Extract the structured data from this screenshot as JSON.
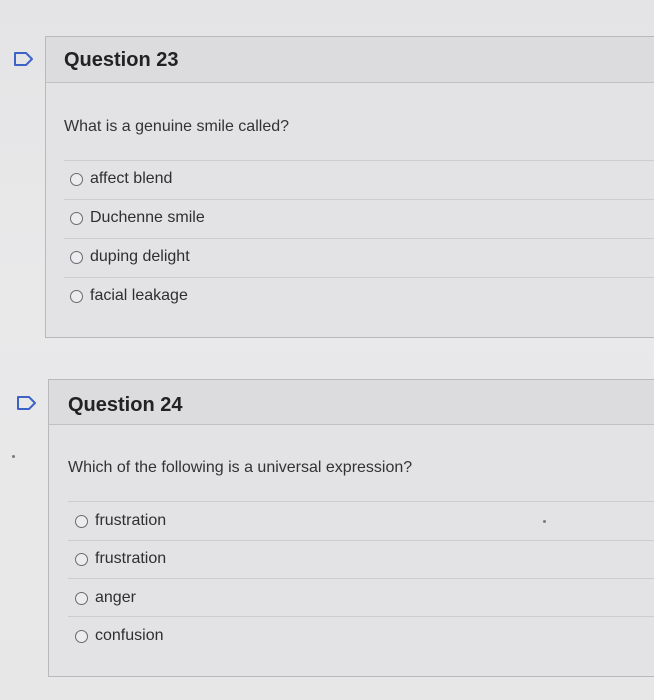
{
  "questions": [
    {
      "title": "Question 23",
      "prompt": "What is a genuine smile called?",
      "options": [
        "affect blend",
        "Duchenne smile",
        "duping delight",
        "facial leakage"
      ]
    },
    {
      "title": "Question 24",
      "prompt": "Which of the following is a universal expression?",
      "options": [
        "frustration",
        "frustration",
        "anger",
        "confusion"
      ]
    }
  ],
  "colors": {
    "flag": "#3e63c7",
    "page_bg": "#e6e6e8",
    "card_border": "#b9b9bc"
  },
  "icons": {
    "flag": "flag-icon",
    "radio": "radio-unselected"
  }
}
